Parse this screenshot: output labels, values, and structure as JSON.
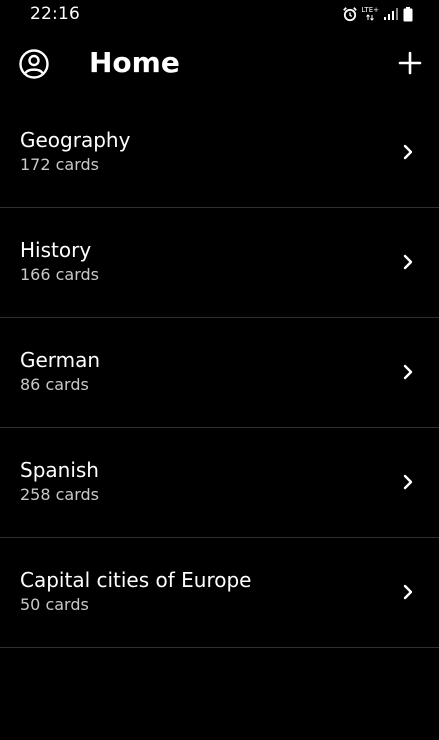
{
  "status_bar": {
    "time": "22:16",
    "network_label": "LTE+",
    "icons": [
      "alarm-icon",
      "data-arrows-icon",
      "signal-icon",
      "battery-icon"
    ]
  },
  "header": {
    "title": "Home",
    "left_icon": "account-circle-icon",
    "right_icon": "plus-icon"
  },
  "decks": [
    {
      "name": "Geography",
      "count": "172 cards"
    },
    {
      "name": "History",
      "count": "166 cards"
    },
    {
      "name": "German",
      "count": "86 cards"
    },
    {
      "name": "Spanish",
      "count": "258 cards"
    },
    {
      "name": "Capital cities of Europe",
      "count": "50 cards"
    }
  ],
  "colors": {
    "background": "#000000",
    "text_primary": "#ffffff",
    "text_secondary": "#c8c8c8",
    "divider": "#2f2f2f"
  }
}
